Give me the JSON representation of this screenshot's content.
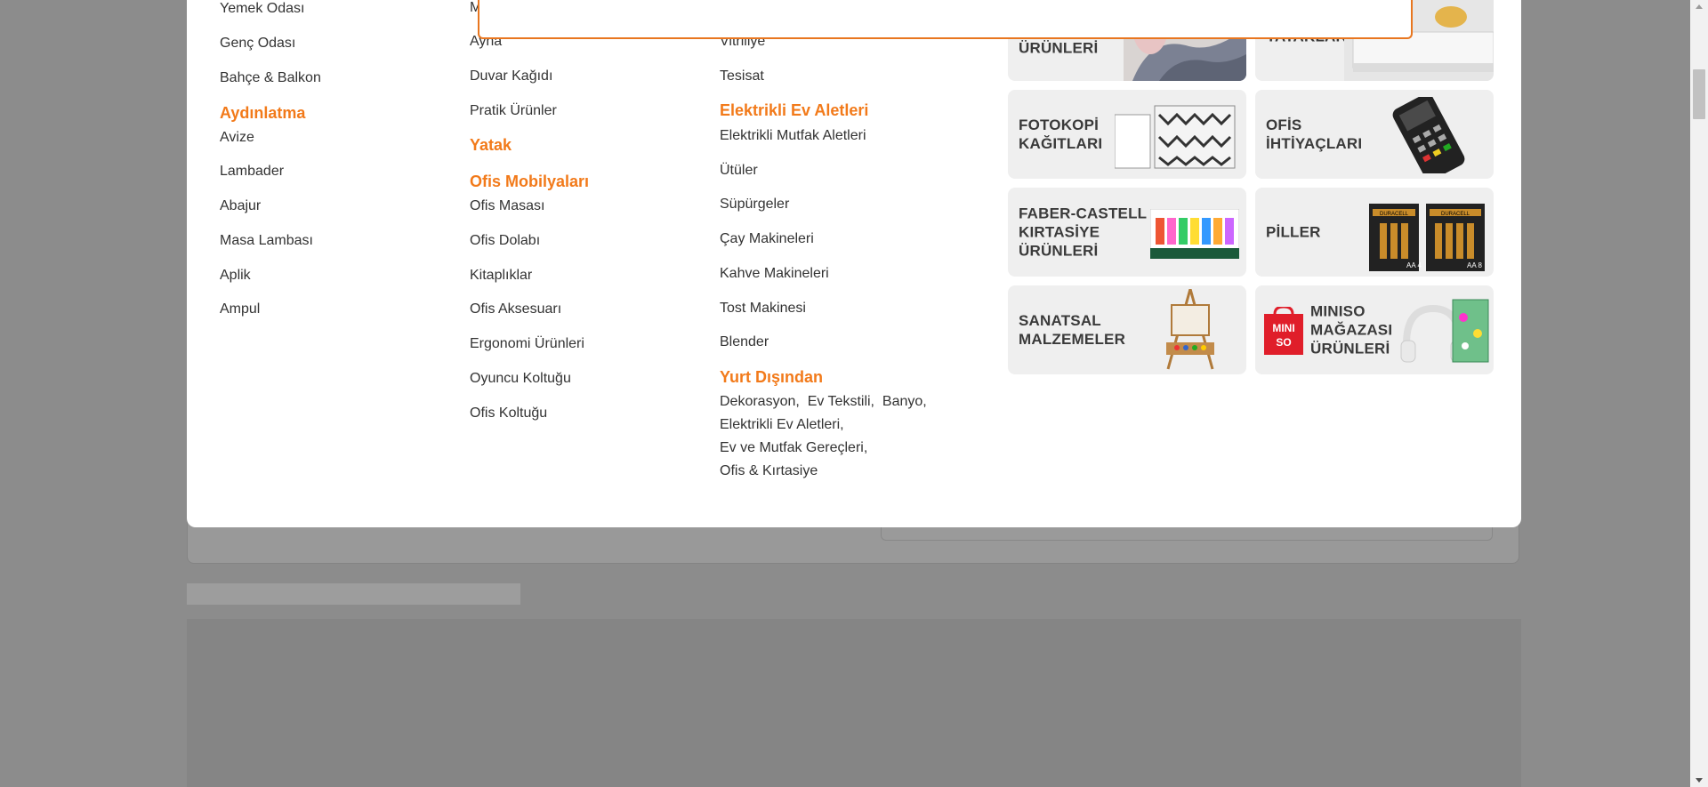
{
  "columns": {
    "col1": {
      "items_top": [
        "Yemek Odası",
        "Genç Odası",
        "Bahçe & Balkon"
      ],
      "lighting_heading": "Aydınlatma",
      "lighting_items": [
        "Avize",
        "Lambader",
        "Abajur",
        "Masa Lambası",
        "Aplik",
        "Ampul"
      ]
    },
    "col2": {
      "cut_item": "M",
      "items_top": [
        "Ayna",
        "Duvar Kağıdı",
        "Pratik Ürünler"
      ],
      "bed_heading": "Yatak",
      "office_heading": "Ofis Mobilyaları",
      "office_items": [
        "Ofis Masası",
        "Ofis Dolabı",
        "Kitaplıklar",
        "Ofis Aksesuarı",
        "Ergonomi Ürünleri",
        "Oyuncu Koltuğu",
        "Ofis Koltuğu"
      ]
    },
    "col3": {
      "items_top": [
        "Vitriliye",
        "Tesisat"
      ],
      "appliances_heading": "Elektrikli Ev Aletleri",
      "appliances_items": [
        "Elektrikli Mutfak Aletleri",
        "Ütüler",
        "Süpürgeler",
        "Çay Makineleri",
        "Kahve Makineleri",
        "Tost Makinesi",
        "Blender"
      ],
      "abroad_heading": "Yurt Dışından",
      "abroad_items": [
        "Dekorasyon,",
        "Ev Tekstili,",
        "Banyo,",
        "Elektrikli Ev Aletleri,",
        "Ev ve Mutfak Gereçleri,",
        "Ofis & Kırtasiye"
      ]
    }
  },
  "tiles": {
    "textile": "ÜRÜNLERİ",
    "beds": "YATAKLAR",
    "copy_paper": "FOTOKOPİ KAĞITLARI",
    "office_needs": "OFİS İHTİYAÇLARI",
    "faber": "FABER-CASTELL KIRTASİYE ÜRÜNLERİ",
    "batteries": "PİLLER",
    "art": "SANATSAL MALZEMELER",
    "miniso": "MINISO MAĞAZASI ÜRÜNLERİ",
    "miniso_logo": "MINI SO",
    "duracell_brand": "DURACELL",
    "battery_labels": [
      "AA 4",
      "AA 8"
    ]
  },
  "colors": {
    "accent": "#f27a1a",
    "search_border": "#e8761f",
    "overlay": "#8c8c8c"
  }
}
